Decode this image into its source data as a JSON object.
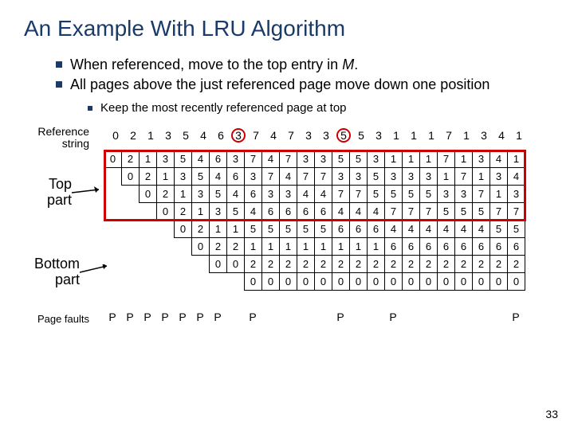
{
  "title": "An Example With LRU Algorithm",
  "bullets": [
    {
      "text_pre": "When referenced, move to the top entry in ",
      "ital": "M",
      "text_post": "."
    },
    {
      "text_pre": "All pages above the just referenced page move down one position",
      "ital": "",
      "text_post": ""
    }
  ],
  "sub_bullet": "Keep the most recently referenced page at top",
  "labels": {
    "reference": "Reference string",
    "top": "Top part",
    "bottom": "Bottom part",
    "faults": "Page faults"
  },
  "ref_string": [
    "0",
    "2",
    "1",
    "3",
    "5",
    "4",
    "6",
    "3",
    "7",
    "4",
    "7",
    "3",
    "3",
    "5",
    "5",
    "3",
    "1",
    "1",
    "1",
    "7",
    "1",
    "3",
    "4",
    "1"
  ],
  "circled_refs": [
    7,
    13
  ],
  "grid": [
    [
      "0",
      "2",
      "1",
      "3",
      "5",
      "4",
      "6",
      "3",
      "7",
      "4",
      "7",
      "3",
      "3",
      "5",
      "5",
      "3",
      "1",
      "1",
      "1",
      "7",
      "1",
      "3",
      "4",
      "1"
    ],
    [
      "",
      "0",
      "2",
      "1",
      "3",
      "5",
      "4",
      "6",
      "3",
      "7",
      "4",
      "7",
      "7",
      "3",
      "3",
      "5",
      "3",
      "3",
      "3",
      "1",
      "7",
      "1",
      "3",
      "4"
    ],
    [
      "",
      "",
      "0",
      "2",
      "1",
      "3",
      "5",
      "4",
      "6",
      "3",
      "3",
      "4",
      "4",
      "7",
      "7",
      "5",
      "5",
      "5",
      "5",
      "3",
      "3",
      "7",
      "1",
      "3"
    ],
    [
      "",
      "",
      "",
      "0",
      "2",
      "1",
      "3",
      "5",
      "4",
      "6",
      "6",
      "6",
      "6",
      "4",
      "4",
      "4",
      "7",
      "7",
      "7",
      "5",
      "5",
      "5",
      "7",
      "7"
    ],
    [
      "",
      "",
      "",
      "",
      "0",
      "2",
      "1",
      "1",
      "5",
      "5",
      "5",
      "5",
      "5",
      "6",
      "6",
      "6",
      "4",
      "4",
      "4",
      "4",
      "4",
      "4",
      "5",
      "5"
    ],
    [
      "",
      "",
      "",
      "",
      "",
      "0",
      "2",
      "2",
      "1",
      "1",
      "1",
      "1",
      "1",
      "1",
      "1",
      "1",
      "6",
      "6",
      "6",
      "6",
      "6",
      "6",
      "6",
      "6"
    ],
    [
      "",
      "",
      "",
      "",
      "",
      "",
      "0",
      "0",
      "2",
      "2",
      "2",
      "2",
      "2",
      "2",
      "2",
      "2",
      "2",
      "2",
      "2",
      "2",
      "2",
      "2",
      "2",
      "2"
    ],
    [
      "",
      "",
      "",
      "",
      "",
      "",
      "",
      "",
      "0",
      "0",
      "0",
      "0",
      "0",
      "0",
      "0",
      "0",
      "0",
      "0",
      "0",
      "0",
      "0",
      "0",
      "0",
      "0"
    ]
  ],
  "top_rows": 4,
  "page_faults": [
    "P",
    "P",
    "P",
    "P",
    "P",
    "P",
    "P",
    "",
    "P",
    "",
    "",
    "",
    "",
    "P",
    "",
    "",
    "P",
    "",
    "",
    "",
    "",
    "",
    "",
    "P"
  ],
  "page_number": "33"
}
